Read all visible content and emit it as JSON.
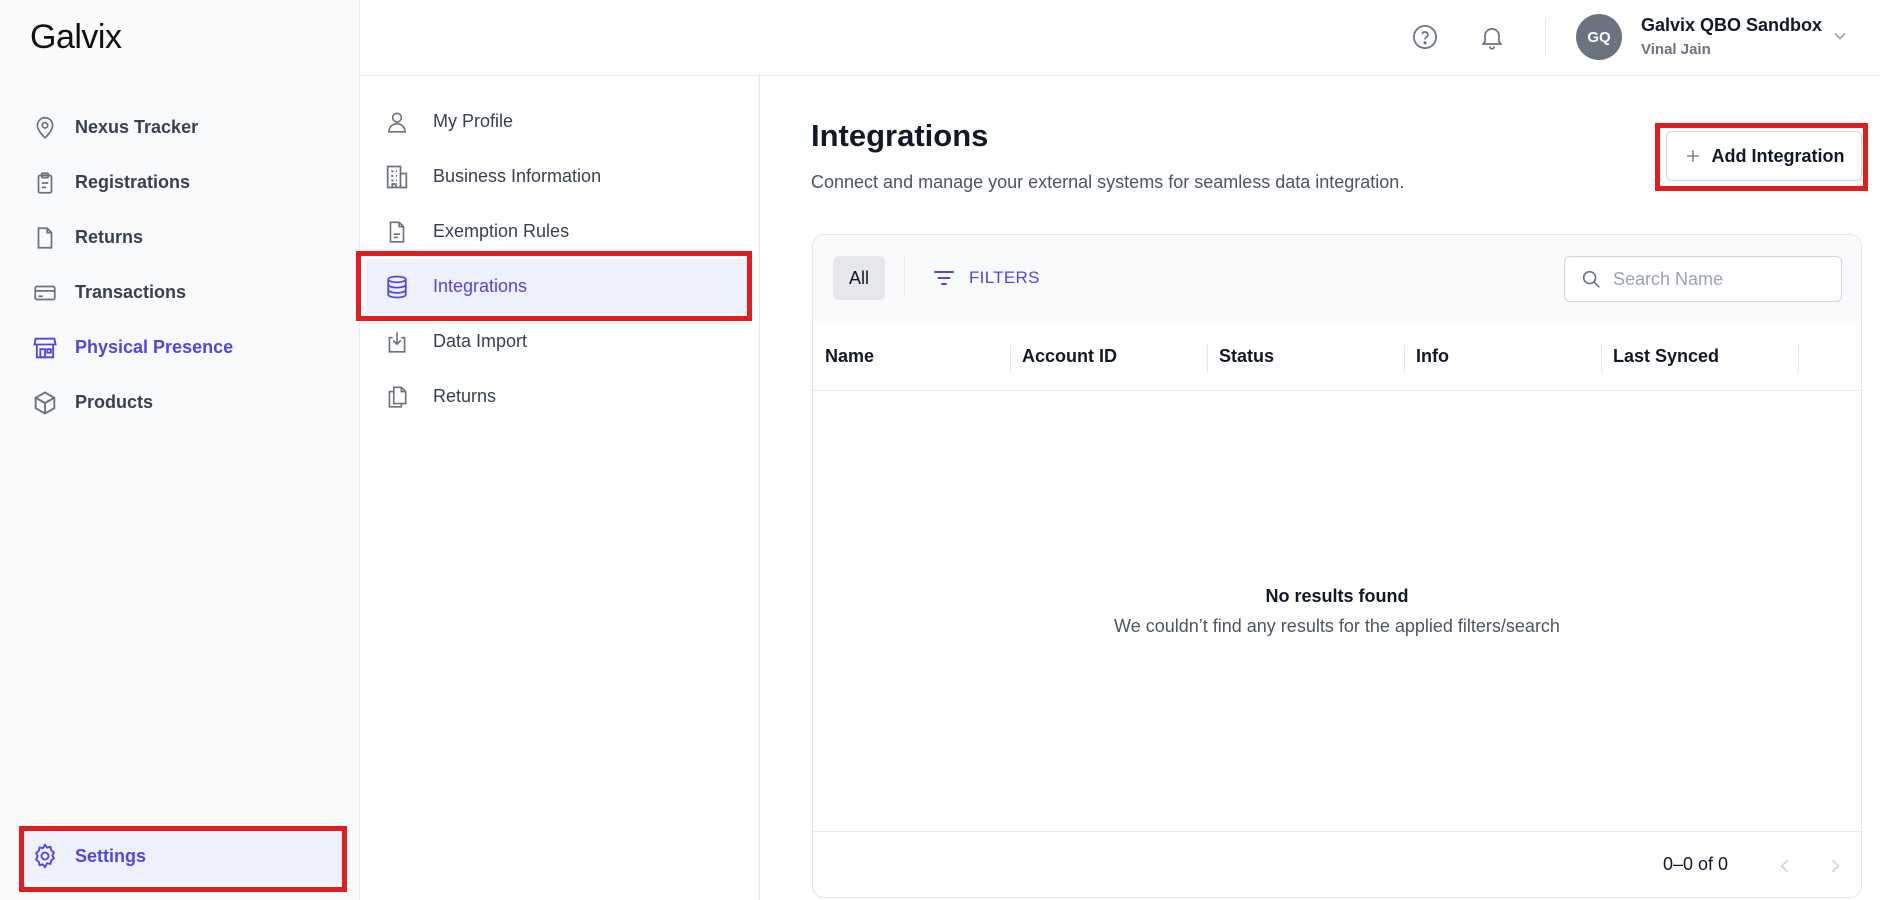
{
  "app": {
    "logo_text": "Galvix"
  },
  "sidebar": {
    "items": [
      {
        "label": "Nexus Tracker",
        "icon": "map-pin-icon"
      },
      {
        "label": "Registrations",
        "icon": "clipboard-icon"
      },
      {
        "label": "Returns",
        "icon": "file-icon"
      },
      {
        "label": "Transactions",
        "icon": "credit-card-icon"
      },
      {
        "label": "Physical Presence",
        "icon": "store-icon"
      },
      {
        "label": "Products",
        "icon": "box-icon"
      }
    ],
    "settings_label": "Settings"
  },
  "header": {
    "avatar_initials": "GQ",
    "account_name": "Galvix QBO Sandbox",
    "user_name": "Vinal Jain"
  },
  "submenu": {
    "items": [
      {
        "label": "My Profile",
        "icon": "user-icon"
      },
      {
        "label": "Business Information",
        "icon": "building-icon"
      },
      {
        "label": "Exemption Rules",
        "icon": "document-icon"
      },
      {
        "label": "Integrations",
        "icon": "database-icon"
      },
      {
        "label": "Data Import",
        "icon": "download-icon"
      },
      {
        "label": "Returns",
        "icon": "copy-icon"
      }
    ]
  },
  "main": {
    "title": "Integrations",
    "subtitle": "Connect and manage your external systems for seamless data integration.",
    "add_button": "Add Integration",
    "tab_all": "All",
    "filters_label": "FILTERS",
    "search_placeholder": "Search Name",
    "columns": [
      "Name",
      "Account ID",
      "Status",
      "Info",
      "Last Synced"
    ],
    "empty_title": "No results found",
    "empty_subtitle": "We couldn’t find any results for the applied filters/search",
    "pagination": "0–0 of 0"
  },
  "colors": {
    "accent": "#5046e5",
    "highlight": "#e11d1d",
    "sidebar_bg": "#f9fafb",
    "active_bg": "#eef0fb"
  }
}
